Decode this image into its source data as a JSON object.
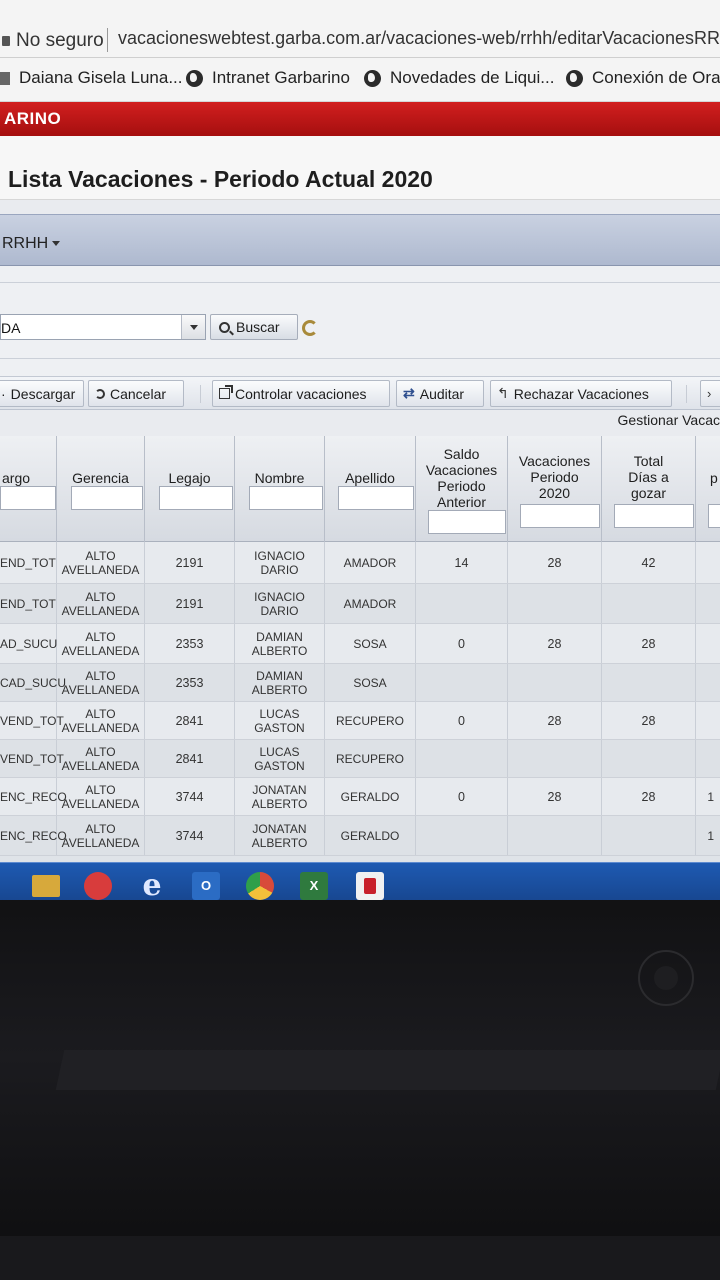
{
  "browser": {
    "insecure_label": "No seguro",
    "url": "vacacioneswebtest.garba.com.ar/vacaciones-web/rrhh/editarVacacionesRR"
  },
  "bookmarks": [
    {
      "label": "Daiana Gisela Luna..."
    },
    {
      "label": "Intranet Garbarino"
    },
    {
      "label": "Novedades de Liqui..."
    },
    {
      "label": "Conexión de Orac"
    }
  ],
  "brand": {
    "text": "ARINO",
    "color": "#c81818"
  },
  "page": {
    "title": "Lista Vacaciones - Periodo Actual 2020"
  },
  "menu": {
    "rrhh_label": "RRHH"
  },
  "filter": {
    "selected_value": "DA",
    "search_label": "Buscar"
  },
  "toolbar": {
    "download_label": "Descargar",
    "cancel_label": "Cancelar",
    "control_label": "Controlar vacaciones",
    "audit_label": "Auditar",
    "reject_label": "Rechazar Vacaciones"
  },
  "section": {
    "label": "Gestionar Vacac"
  },
  "table": {
    "headers": {
      "cargo": "argo",
      "gerencia": "Gerencia",
      "legajo": "Legajo",
      "nombre": "Nombre",
      "apellido": "Apellido",
      "saldo": "Saldo Vacaciones Periodo Anterior",
      "vacaciones": "Vacaciones Periodo 2020",
      "total": "Total Días a gozar",
      "extra": "p"
    },
    "rows": [
      {
        "cargo": "END_TOT",
        "gerencia": "ALTO AVELLANEDA",
        "legajo": "2191",
        "nombre": "IGNACIO DARIO",
        "apellido": "AMADOR",
        "saldo": "14",
        "vacaciones": "28",
        "total": "42",
        "extra": ""
      },
      {
        "cargo": "END_TOT",
        "gerencia": "ALTO AVELLANEDA",
        "legajo": "2191",
        "nombre": "IGNACIO DARIO",
        "apellido": "AMADOR",
        "saldo": "",
        "vacaciones": "",
        "total": "",
        "extra": ""
      },
      {
        "cargo": "AD_SUCU",
        "gerencia": "ALTO AVELLANEDA",
        "legajo": "2353",
        "nombre": "DAMIAN ALBERTO",
        "apellido": "SOSA",
        "saldo": "0",
        "vacaciones": "28",
        "total": "28",
        "extra": ""
      },
      {
        "cargo": "CAD_SUCU",
        "gerencia": "ALTO AVELLANEDA",
        "legajo": "2353",
        "nombre": "DAMIAN ALBERTO",
        "apellido": "SOSA",
        "saldo": "",
        "vacaciones": "",
        "total": "",
        "extra": ""
      },
      {
        "cargo": "VEND_TOT",
        "gerencia": "ALTO AVELLANEDA",
        "legajo": "2841",
        "nombre": "LUCAS GASTON",
        "apellido": "RECUPERO",
        "saldo": "0",
        "vacaciones": "28",
        "total": "28",
        "extra": ""
      },
      {
        "cargo": "VEND_TOT",
        "gerencia": "ALTO AVELLANEDA",
        "legajo": "2841",
        "nombre": "LUCAS GASTON",
        "apellido": "RECUPERO",
        "saldo": "",
        "vacaciones": "",
        "total": "",
        "extra": ""
      },
      {
        "cargo": "ENC_RECO",
        "gerencia": "ALTO AVELLANEDA",
        "legajo": "3744",
        "nombre": "JONATAN ALBERTO",
        "apellido": "GERALDO",
        "saldo": "0",
        "vacaciones": "28",
        "total": "28",
        "extra": "1"
      },
      {
        "cargo": "ENC_RECO",
        "gerencia": "ALTO AVELLANEDA",
        "legajo": "3744",
        "nombre": "JONATAN ALBERTO",
        "apellido": "GERALDO",
        "saldo": "",
        "vacaciones": "",
        "total": "",
        "extra": "1"
      }
    ]
  },
  "taskbar": {
    "icons": [
      "folder-icon",
      "skype-icon",
      "internet-explorer-icon",
      "outlook-icon",
      "chrome-icon",
      "excel-icon",
      "app-icon"
    ],
    "ie_glyph": "e",
    "outlook_glyph": "O",
    "excel_glyph": "X"
  }
}
